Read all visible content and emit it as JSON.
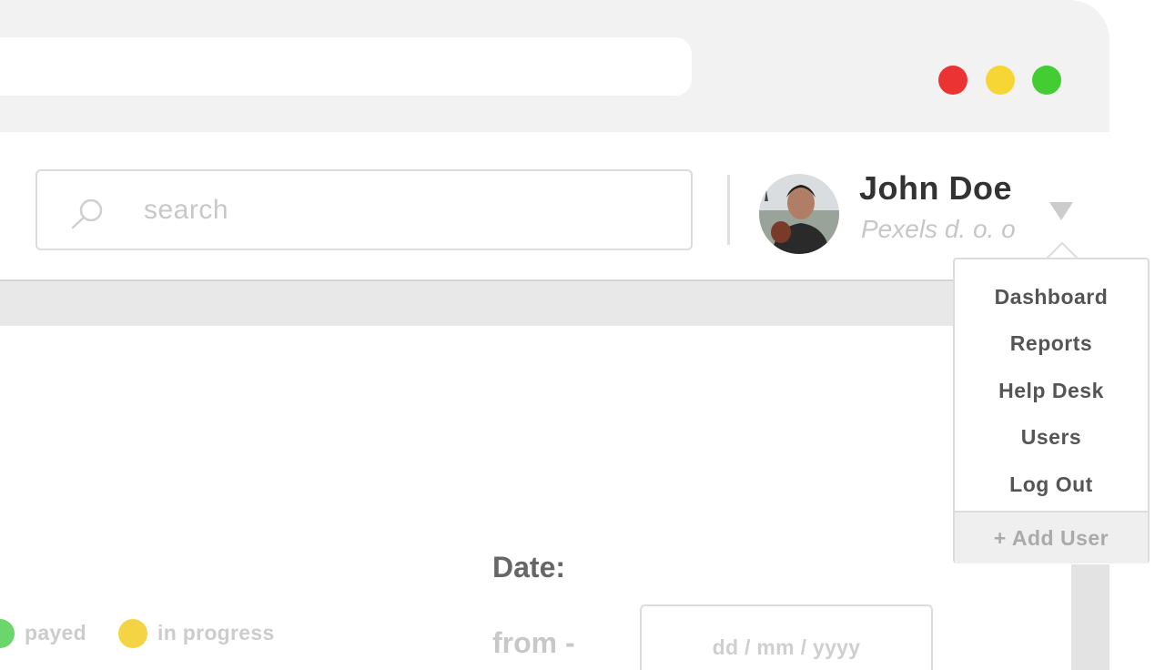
{
  "window": {
    "controls": [
      {
        "name": "close",
        "color": "#ec3333"
      },
      {
        "name": "minimize",
        "color": "#f6d635"
      },
      {
        "name": "maximize",
        "color": "#44cc33"
      }
    ]
  },
  "header": {
    "search": {
      "placeholder": "search"
    },
    "user": {
      "name": "John Doe",
      "company": "Pexels d. o. o"
    }
  },
  "user_menu": {
    "items": [
      {
        "label": "Dashboard"
      },
      {
        "label": "Reports"
      },
      {
        "label": "Help Desk"
      },
      {
        "label": "Users"
      },
      {
        "label": "Log Out"
      }
    ],
    "footer_label": "+ Add User"
  },
  "legend": {
    "items": [
      {
        "label": "payed",
        "color": "#6bd66b"
      },
      {
        "label": "in progress",
        "color": "#f4d445"
      }
    ]
  },
  "date_filter": {
    "title": "Date:",
    "from_label": "from -",
    "from_placeholder": "dd /  mm / yyyy"
  },
  "colors": {
    "chrome": "#f2f2f2",
    "border": "#dcdcdc",
    "text_dark": "#333333",
    "text_muted": "#c8c8c8"
  }
}
